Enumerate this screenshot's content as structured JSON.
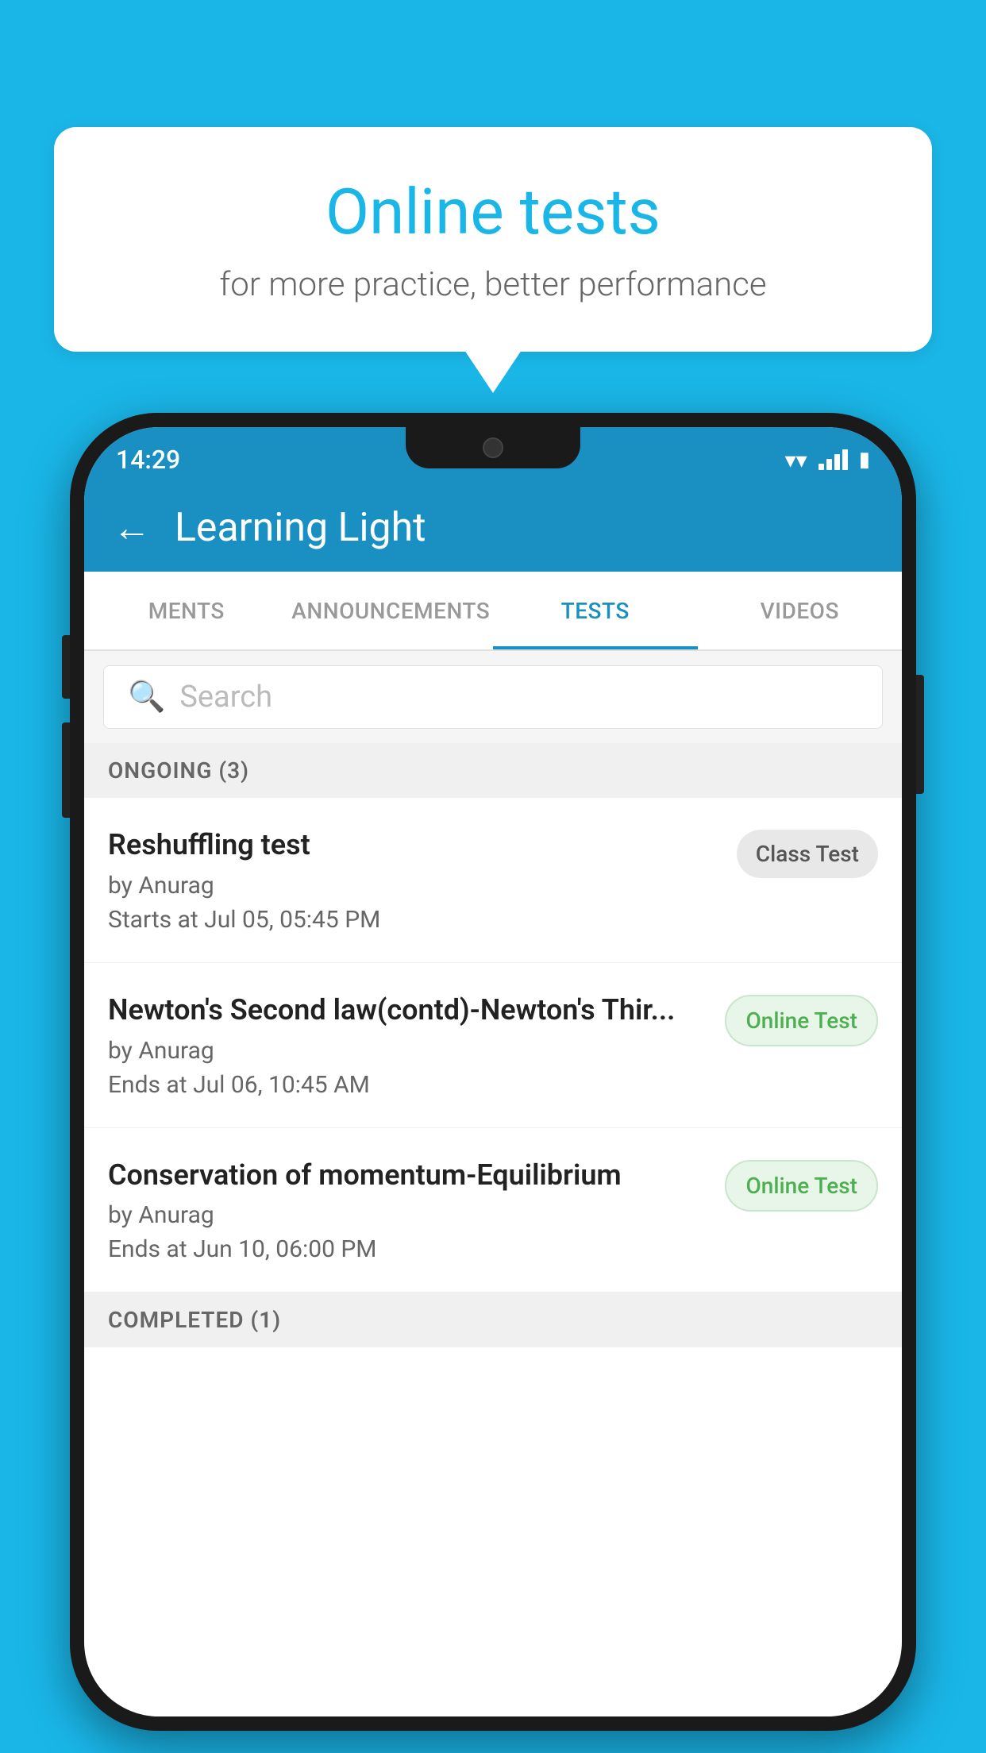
{
  "background_color": "#1ab6e8",
  "speech_bubble": {
    "title": "Online tests",
    "subtitle": "for more practice, better performance"
  },
  "phone": {
    "status_bar": {
      "time": "14:29"
    },
    "header": {
      "title": "Learning Light",
      "back_label": "←"
    },
    "tabs": [
      {
        "label": "MENTS",
        "active": false
      },
      {
        "label": "ANNOUNCEMENTS",
        "active": false
      },
      {
        "label": "TESTS",
        "active": true
      },
      {
        "label": "VIDEOS",
        "active": false
      }
    ],
    "search": {
      "placeholder": "Search"
    },
    "sections": [
      {
        "header": "ONGOING (3)",
        "items": [
          {
            "name": "Reshuffling test",
            "author": "by Anurag",
            "time_label": "Starts at",
            "time": "Jul 05, 05:45 PM",
            "badge": "Class Test",
            "badge_type": "class"
          },
          {
            "name": "Newton's Second law(contd)-Newton's Thir...",
            "author": "by Anurag",
            "time_label": "Ends at",
            "time": "Jul 06, 10:45 AM",
            "badge": "Online Test",
            "badge_type": "online"
          },
          {
            "name": "Conservation of momentum-Equilibrium",
            "author": "by Anurag",
            "time_label": "Ends at",
            "time": "Jun 10, 06:00 PM",
            "badge": "Online Test",
            "badge_type": "online"
          }
        ]
      }
    ],
    "completed_section": "COMPLETED (1)"
  }
}
